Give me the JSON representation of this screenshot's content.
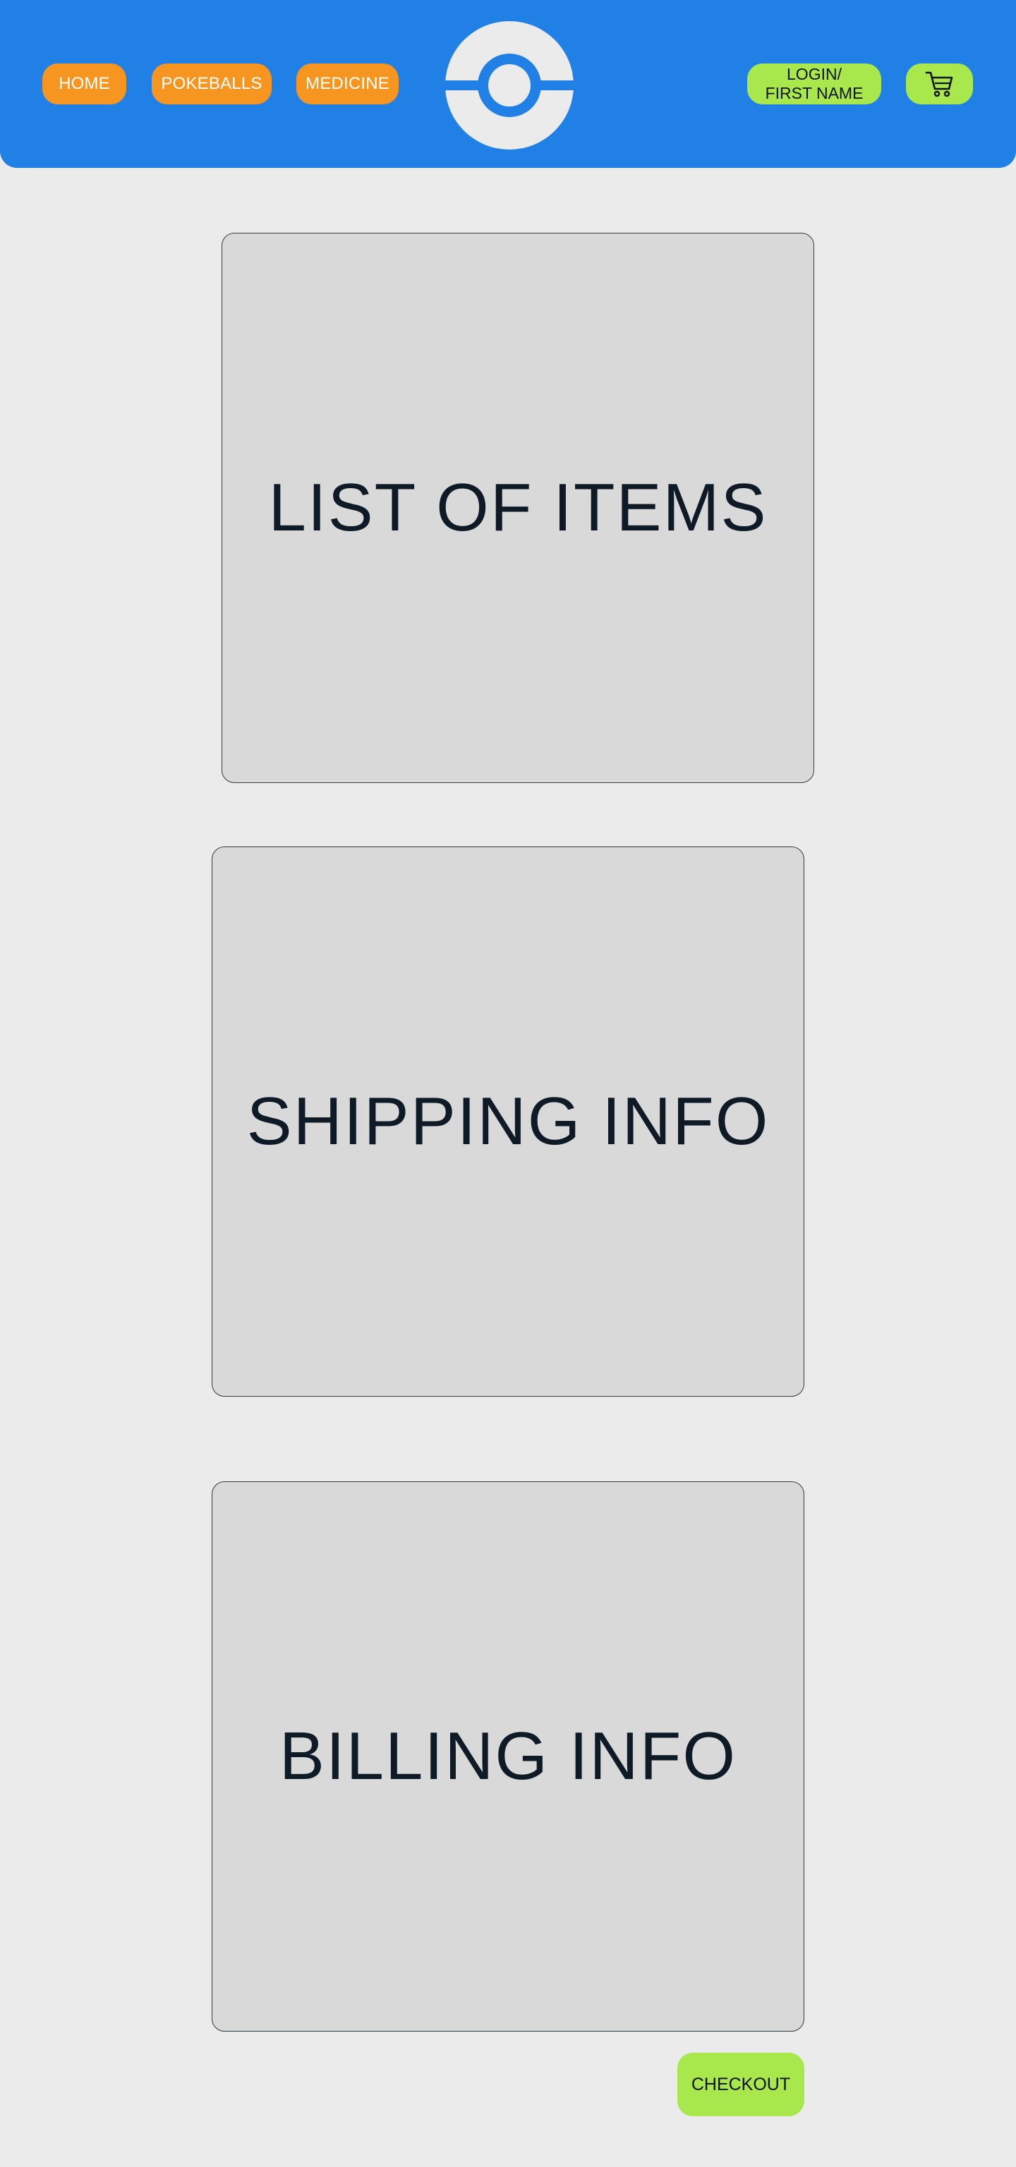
{
  "header": {
    "background_color": "#2180e6",
    "nav": {
      "home_label": "HOME",
      "pokeballs_label": "POKEBALLS",
      "medicine_label": "MEDICINE",
      "color": "#f6951f"
    },
    "logo_icon": "pokeball-icon",
    "login": {
      "line1": "LOGIN/",
      "line2": "FIRST NAME"
    },
    "cart_icon": "shopping-cart-icon",
    "action_color": "#a8e84c"
  },
  "main": {
    "items_panel_label": "LIST OF ITEMS",
    "shipping_panel_label": "SHIPPING INFO",
    "billing_panel_label": "BILLING INFO",
    "checkout_label": "CHECKOUT"
  }
}
